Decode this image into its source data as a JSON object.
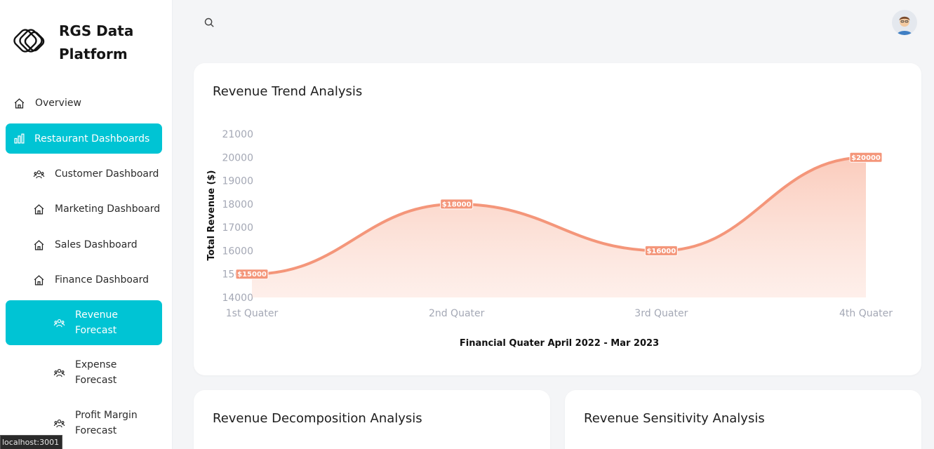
{
  "brand": {
    "name": "RGS Data Platform"
  },
  "sidebar": {
    "items": [
      {
        "label": "Overview",
        "icon": "home-icon"
      },
      {
        "label": "Restaurant Dashboards",
        "icon": "bar-chart-icon",
        "active": true
      },
      {
        "label": "Customer Dashboard",
        "icon": "users-icon"
      },
      {
        "label": "Marketing Dashboard",
        "icon": "home-icon"
      },
      {
        "label": "Sales Dashboard",
        "icon": "home-icon"
      },
      {
        "label": "Finance Dashboard",
        "icon": "home-icon"
      },
      {
        "label": "Revenue Forecast",
        "icon": "users-icon",
        "active": true
      },
      {
        "label": "Expense Forecast",
        "icon": "users-icon"
      },
      {
        "label": "Profit Margin Forecast",
        "icon": "users-icon"
      }
    ]
  },
  "status_bar": {
    "url": "localhost:3001"
  },
  "header": {
    "search_icon": "search-icon",
    "avatar_icon": "avatar-icon"
  },
  "colors": {
    "accent": "#00c4d4",
    "series": "#f4967a",
    "label_bg": "#f4967a"
  },
  "cards": {
    "trend": {
      "title": "Revenue Trend Analysis"
    },
    "decomposition": {
      "title": "Revenue Decomposition Analysis"
    },
    "sensitivity": {
      "title": "Revenue Sensitivity Analysis"
    }
  },
  "chart_data": {
    "type": "area",
    "categories": [
      "1st Quater",
      "2nd Quater",
      "3rd Quater",
      "4th Quater"
    ],
    "series": [
      {
        "values": [
          15000,
          18000,
          16000,
          20000
        ]
      }
    ],
    "data_labels": [
      "$15000",
      "$18000",
      "$16000",
      "$20000"
    ],
    "y_ticks": [
      14000,
      15000,
      16000,
      17000,
      18000,
      19000,
      20000,
      21000
    ],
    "ylim": [
      14000,
      21000
    ],
    "xlabel": "Financial Quater April 2022 - Mar 2023",
    "ylabel": "Total Revenue ($)",
    "grid": false,
    "legend": false
  }
}
